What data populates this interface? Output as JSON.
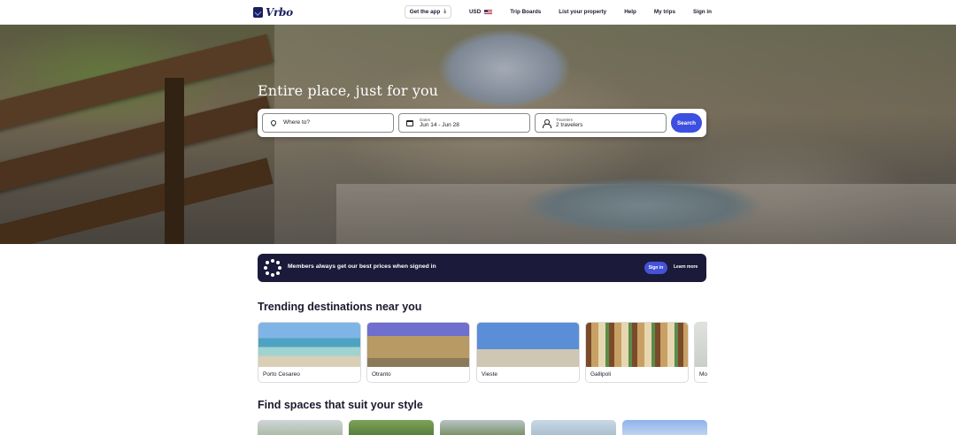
{
  "header": {
    "logo_text": "Vrbo",
    "nav": {
      "get_app": "Get the app",
      "currency": "USD",
      "trip_boards": "Trip Boards",
      "list_property": "List your property",
      "help": "Help",
      "my_trips": "My trips",
      "sign_in": "Sign in"
    }
  },
  "hero": {
    "title": "Entire place, just for you"
  },
  "search": {
    "where": {
      "placeholder": "Where to?"
    },
    "dates": {
      "label": "Dates",
      "value": "Jun 14 - Jun 28"
    },
    "travelers": {
      "label": "Travelers",
      "value": "2 travelers"
    },
    "button": "Search"
  },
  "banner": {
    "text": "Members always get our best prices when signed in",
    "sign_in": "Sign in",
    "learn_more": "Learn more"
  },
  "trending": {
    "title": "Trending destinations near you",
    "items": [
      {
        "name": "Porto Cesareo"
      },
      {
        "name": "Otranto"
      },
      {
        "name": "Vieste"
      },
      {
        "name": "Gallipoli"
      },
      {
        "name": "Mo"
      }
    ]
  },
  "style_section": {
    "title": "Find spaces that suit your style"
  },
  "colors": {
    "brand_navy": "#1b1f5e",
    "search_button": "#3d4fe0",
    "banner_bg": "#1b1a3a"
  }
}
